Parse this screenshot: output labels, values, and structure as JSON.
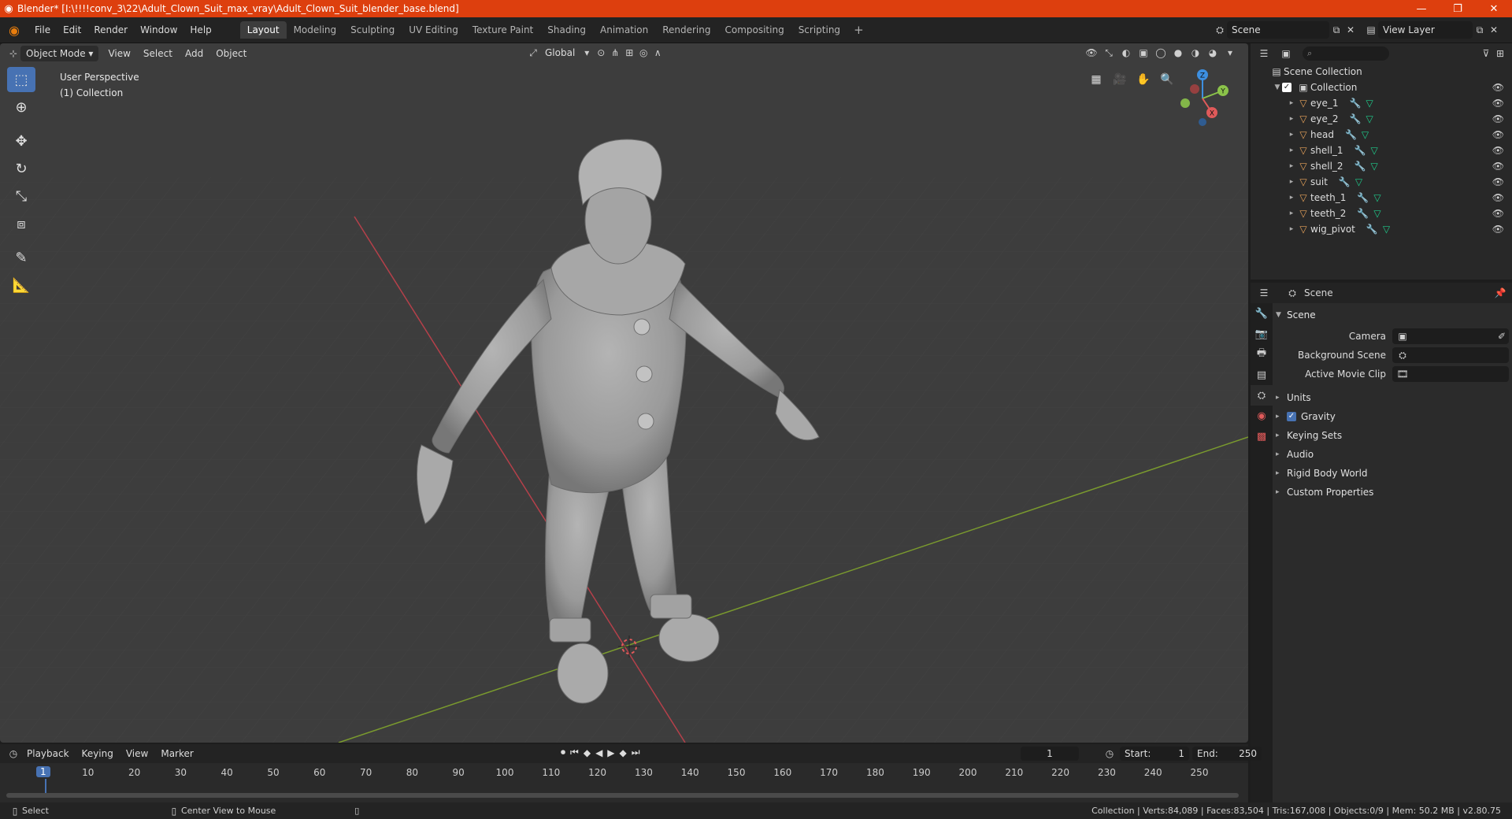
{
  "window": {
    "title": "Blender* [I:\\!!!!conv_3\\22\\Adult_Clown_Suit_max_vray\\Adult_Clown_Suit_blender_base.blend]",
    "minimize": "—",
    "maximize": "❐",
    "close": "✕"
  },
  "menus": [
    "File",
    "Edit",
    "Render",
    "Window",
    "Help"
  ],
  "workspaces": [
    {
      "label": "Layout",
      "active": true
    },
    {
      "label": "Modeling"
    },
    {
      "label": "Sculpting"
    },
    {
      "label": "UV Editing"
    },
    {
      "label": "Texture Paint"
    },
    {
      "label": "Shading"
    },
    {
      "label": "Animation"
    },
    {
      "label": "Rendering"
    },
    {
      "label": "Compositing"
    },
    {
      "label": "Scripting"
    }
  ],
  "scene_name": "Scene",
  "view_layer": "View Layer",
  "viewport": {
    "mode": "Object Mode",
    "menu": [
      "View",
      "Select",
      "Add",
      "Object"
    ],
    "transform_orientation": "Global",
    "perspective_label": "User Perspective",
    "collection_label": "(1) Collection",
    "gizmo": {
      "x": "X",
      "y": "Y",
      "z": "Z"
    }
  },
  "outliner": {
    "root": "Scene Collection",
    "collection": "Collection",
    "objects": [
      "eye_1",
      "eye_2",
      "head",
      "shell_1",
      "shell_2",
      "suit",
      "teeth_1",
      "teeth_2",
      "wig_pivot"
    ]
  },
  "properties": {
    "context": "Scene",
    "panel_title": "Scene",
    "fields": [
      {
        "label": "Camera",
        "value": ""
      },
      {
        "label": "Background Scene",
        "value": ""
      },
      {
        "label": "Active Movie Clip",
        "value": ""
      }
    ],
    "subpanels": [
      {
        "label": "Units",
        "checkbox": false
      },
      {
        "label": "Gravity",
        "checkbox": true
      },
      {
        "label": "Keying Sets",
        "checkbox": false
      },
      {
        "label": "Audio",
        "checkbox": false
      },
      {
        "label": "Rigid Body World",
        "checkbox": false
      },
      {
        "label": "Custom Properties",
        "checkbox": false
      }
    ]
  },
  "timeline": {
    "menus": [
      "Playback",
      "Keying",
      "View",
      "Marker"
    ],
    "current_frame": "1",
    "start_label": "Start:",
    "start": "1",
    "end_label": "End:",
    "end": "250",
    "ticks": [
      "10",
      "20",
      "30",
      "40",
      "50",
      "60",
      "70",
      "80",
      "90",
      "100",
      "110",
      "120",
      "130",
      "140",
      "150",
      "160",
      "170",
      "180",
      "190",
      "200",
      "210",
      "220",
      "230",
      "240",
      "250"
    ]
  },
  "statusbar": {
    "left": "Select",
    "middle": "Center View to Mouse",
    "stats": "Collection | Verts:84,089 | Faces:83,504 | Tris:167,008 | Objects:0/9 | Mem: 50.2 MB | v2.80.75"
  },
  "colors": {
    "titlebar": "#dd3f0e",
    "accent": "#4772b3",
    "x_axis": "#e05a5a",
    "y_axis": "#8bc34a",
    "z_axis": "#3d8fe0"
  }
}
